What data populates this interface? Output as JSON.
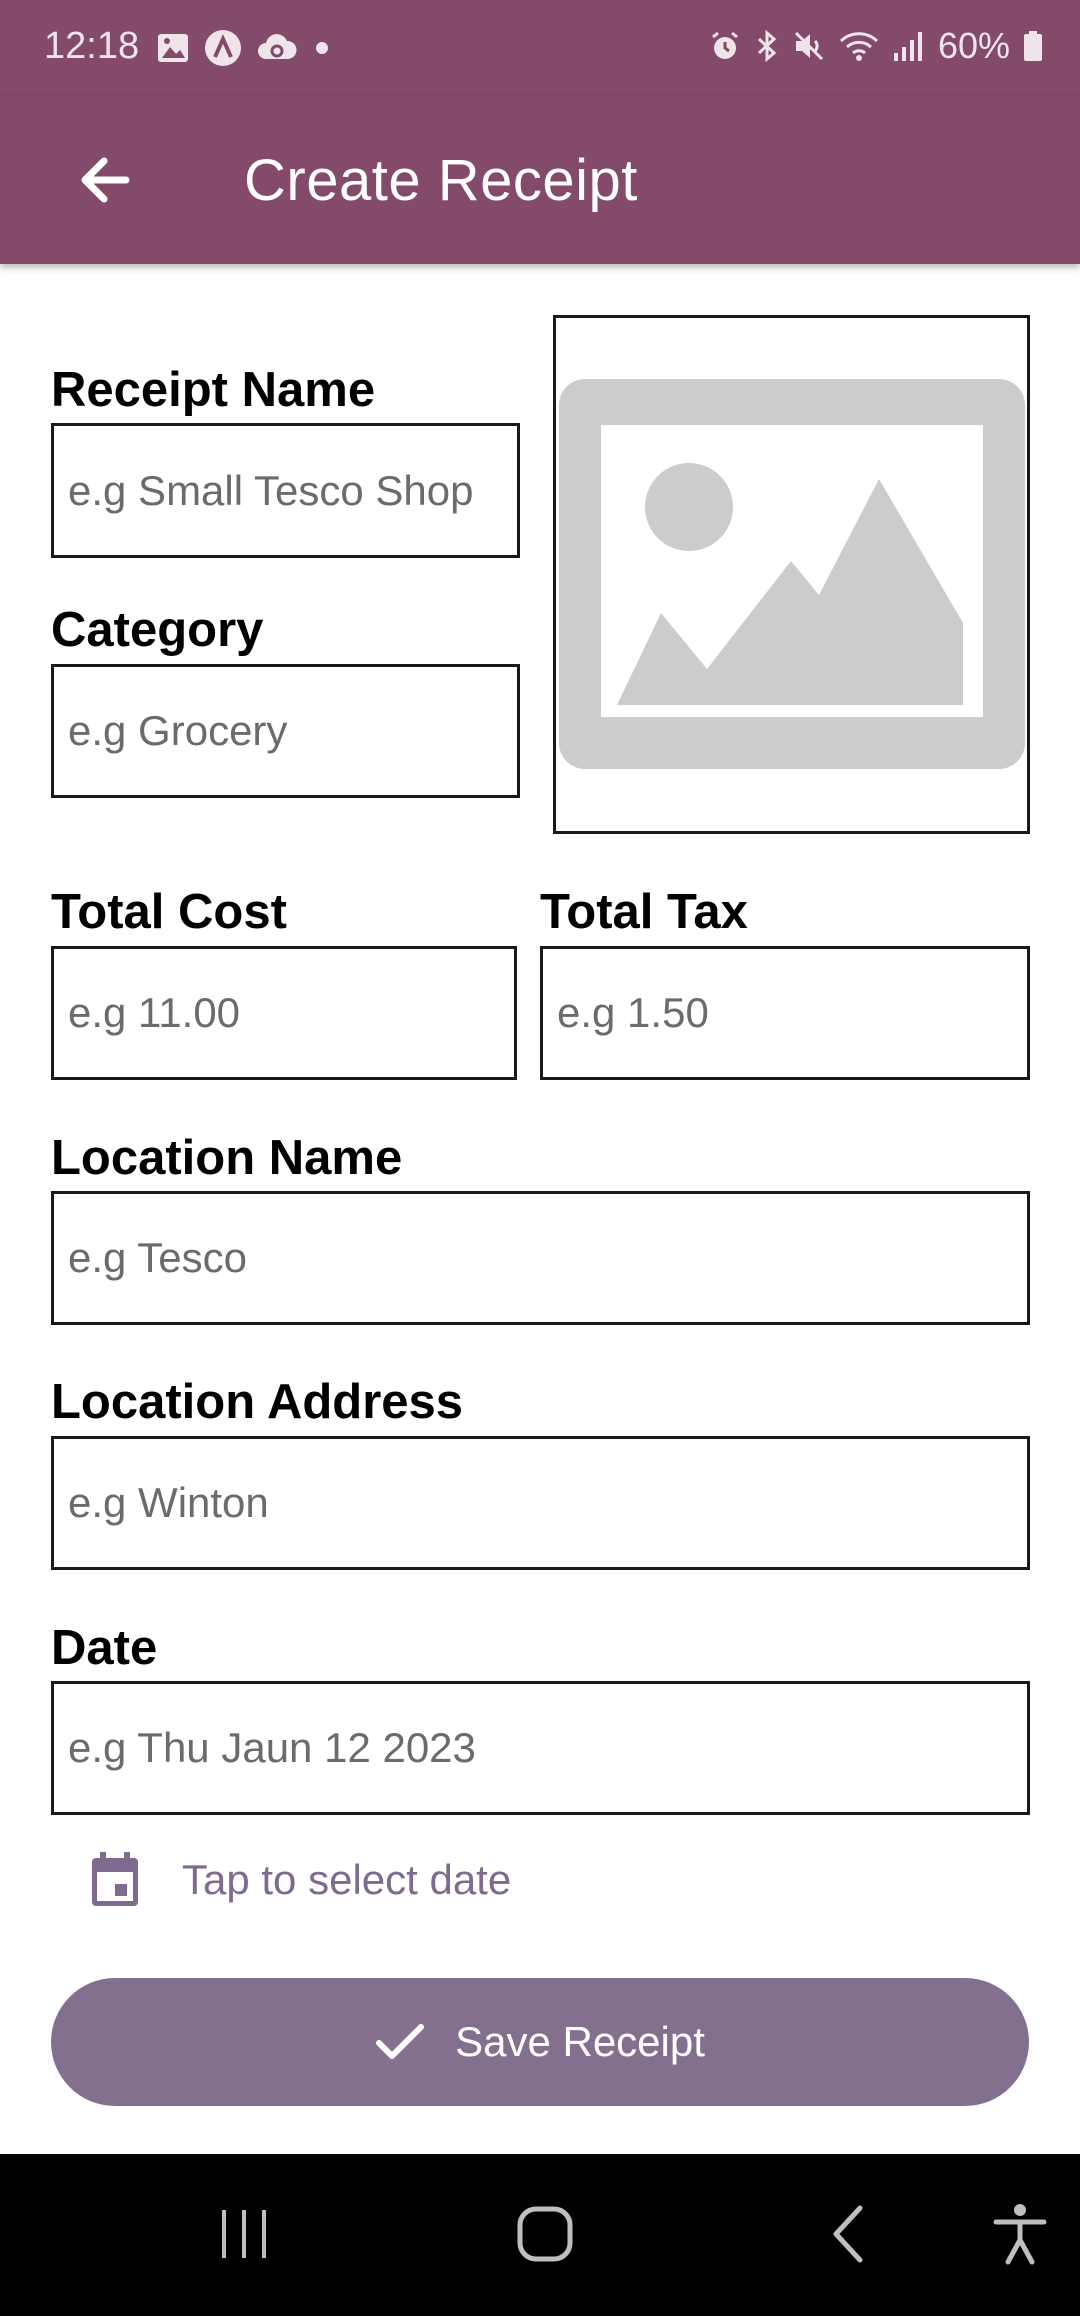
{
  "status_bar": {
    "time": "12:18",
    "battery": "60%",
    "left_icons": [
      "gallery-icon",
      "app-a-icon",
      "cloud-sync-icon",
      "dot-icon"
    ],
    "right_icons": [
      "alarm-icon",
      "bluetooth-icon",
      "mute-icon",
      "wifi-icon",
      "signal-icon",
      "battery-icon"
    ]
  },
  "app_bar": {
    "title": "Create Receipt",
    "back_icon": "arrow-back-icon",
    "background": "#834a6a"
  },
  "form": {
    "receipt_name": {
      "label": "Receipt Name",
      "placeholder": "e.g Small Tesco Shop"
    },
    "category": {
      "label": "Category",
      "placeholder": "e.g Grocery"
    },
    "total_cost": {
      "label": "Total Cost",
      "placeholder": "e.g 11.00"
    },
    "total_tax": {
      "label": "Total Tax",
      "placeholder": "e.g 1.50"
    },
    "location_name": {
      "label": "Location Name",
      "placeholder": "e.g Tesco"
    },
    "location_address": {
      "label": "Location Address",
      "placeholder": "e.g Winton"
    },
    "date": {
      "label": "Date",
      "placeholder": "e.g Thu Jaun 12 2023"
    }
  },
  "image_placeholder": {
    "icon": "image-placeholder-icon"
  },
  "date_picker": {
    "label": "Tap to select date",
    "icon": "calendar-icon",
    "color": "#7f6a90"
  },
  "save_button": {
    "label": "Save Receipt",
    "icon": "check-icon",
    "background": "#83708f"
  },
  "nav_bar": {
    "buttons": [
      "recent-apps-icon",
      "home-icon",
      "back-nav-icon",
      "accessibility-icon"
    ]
  }
}
